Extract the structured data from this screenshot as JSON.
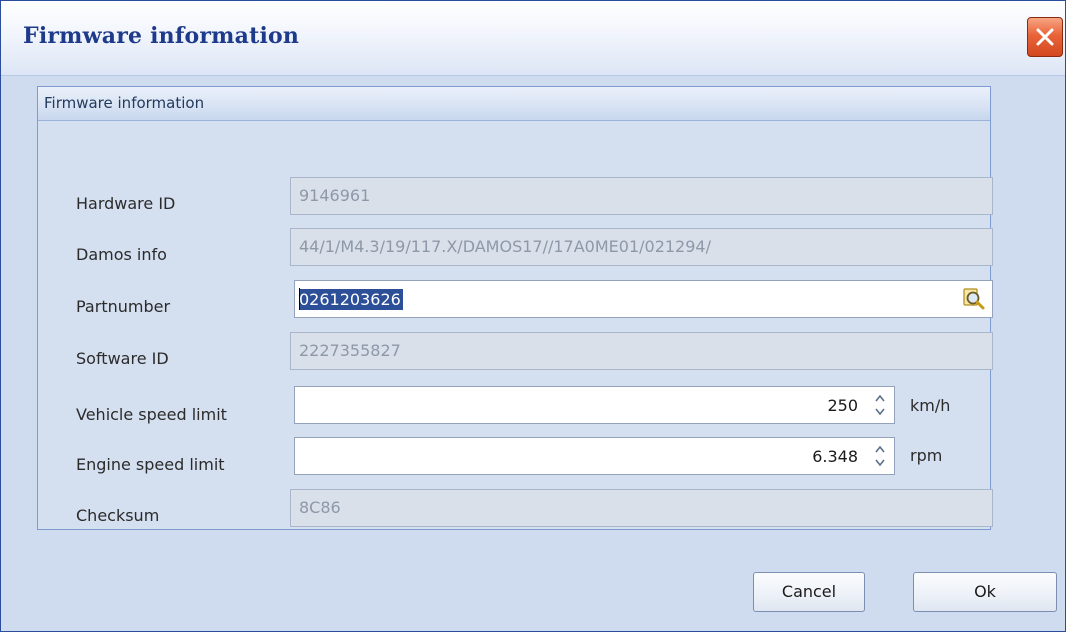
{
  "window": {
    "title": "Firmware information"
  },
  "group": {
    "title": "Firmware information"
  },
  "fields": {
    "hardware_id": {
      "label": "Hardware ID",
      "value": "9146961"
    },
    "damos_info": {
      "label": "Damos info",
      "value": "44/1/M4.3/19/117.X/DAMOS17//17A0ME01/021294/"
    },
    "partnumber": {
      "label": "Partnumber",
      "value": "0261203626"
    },
    "software_id": {
      "label": "Software ID",
      "value": "2227355827"
    },
    "vehicle_speed_limit": {
      "label": "Vehicle speed limit",
      "value": "250",
      "unit": "km/h"
    },
    "engine_speed_limit": {
      "label": "Engine speed limit",
      "value": "6.348",
      "unit": "rpm"
    },
    "checksum": {
      "label": "Checksum",
      "value": "8C86"
    }
  },
  "buttons": {
    "cancel": "Cancel",
    "ok": "Ok"
  },
  "icons": {
    "close": "close-icon",
    "lookup": "magnifier-icon",
    "spin": "spin-updown-icon"
  },
  "colors": {
    "title": "#1e3a8a",
    "close": "#e9643a",
    "selection": "#2d4f97"
  }
}
